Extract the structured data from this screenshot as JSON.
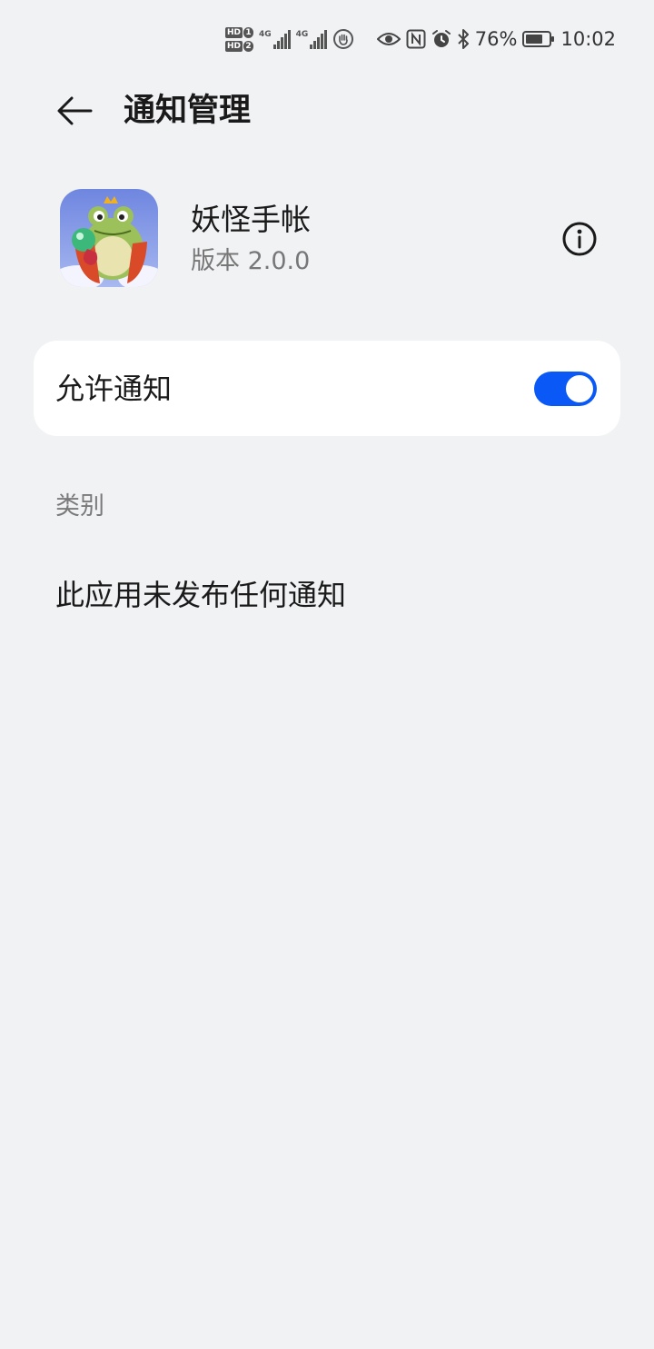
{
  "status_bar": {
    "hd1": "HD",
    "hd1_num": "1",
    "hd2": "HD",
    "hd2_num": "2",
    "net1": "4G",
    "net2": "4G",
    "battery_percent": "76%",
    "time": "10:02",
    "icons": [
      "hd-sim-icon",
      "signal-icon",
      "signal-icon",
      "hand-icon",
      "eye-icon",
      "nfc-icon",
      "alarm-icon",
      "bluetooth-icon",
      "battery-icon"
    ]
  },
  "header": {
    "title": "通知管理",
    "back_icon": "back-arrow-icon"
  },
  "app": {
    "name": "妖怪手帐",
    "version": "版本 2.0.0",
    "info_icon": "info-icon"
  },
  "allow_notifications": {
    "label": "允许通知",
    "enabled": true,
    "accent_color": "#0a59f7"
  },
  "category": {
    "header": "类别",
    "empty_message": "此应用未发布任何通知"
  }
}
